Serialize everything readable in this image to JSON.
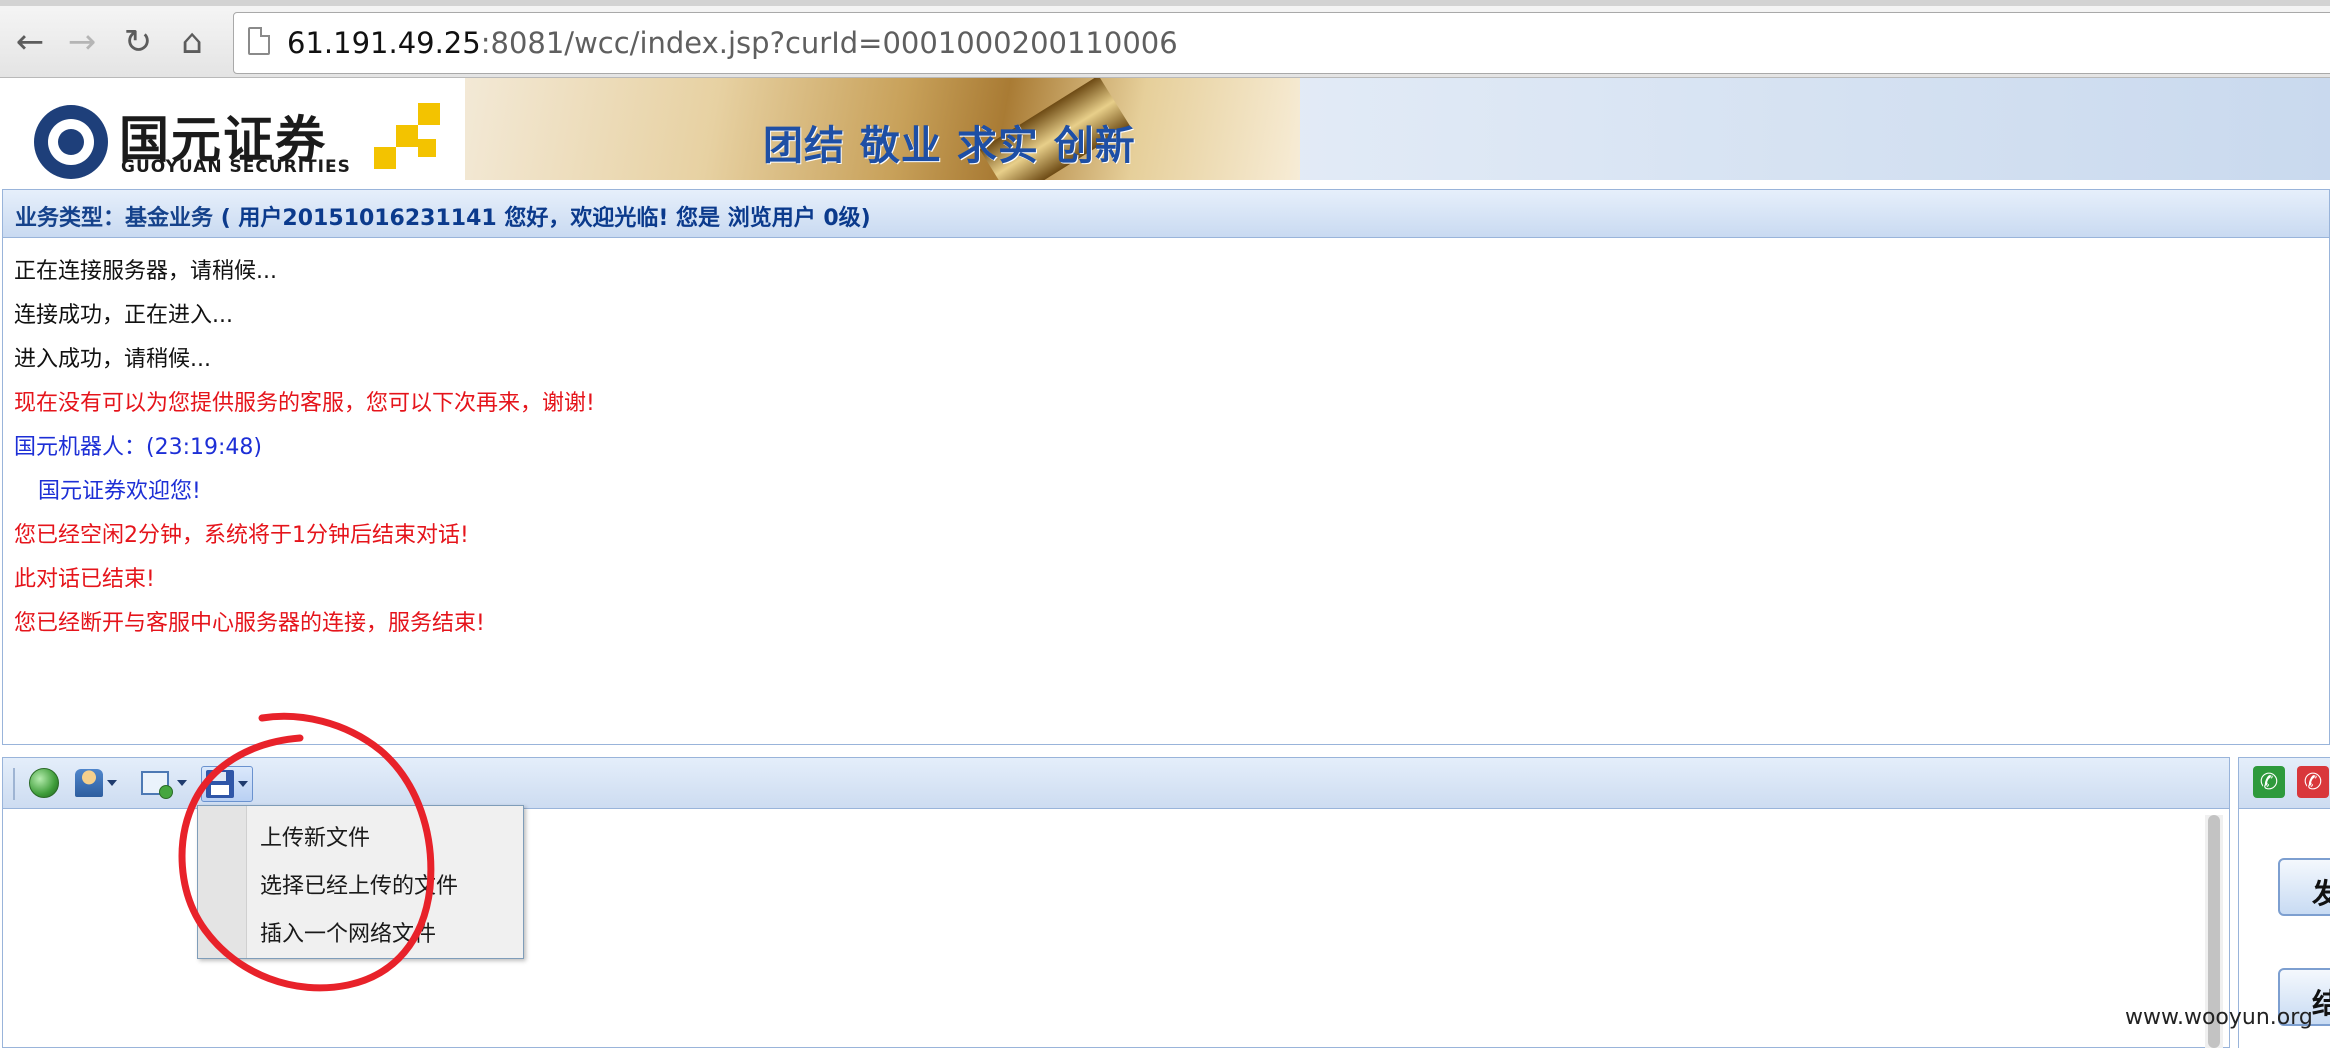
{
  "browser": {
    "url_host": "61.191.49.25",
    "url_rest": ":8081/wcc/index.jsp?curId=0001000200110006",
    "back_icon": "←",
    "forward_icon": "→",
    "reload_icon": "↻",
    "home_icon": "⌂"
  },
  "site": {
    "logo_cn": "国元证券",
    "logo_en": "GUOYUAN SECURITIES",
    "slogan": "团结 敬业 求实 创新",
    "brand_color": "#1e3f7a"
  },
  "status": {
    "label": "业务类型：基金业务",
    "user_text": "( 用户20151016231141 您好，欢迎光临! 您是 浏览用户 0级)"
  },
  "messages": [
    {
      "text": "正在连接服务器，请稍候...",
      "color": "black"
    },
    {
      "text": "连接成功，正在进入...",
      "color": "black"
    },
    {
      "text": "进入成功，请稍候...",
      "color": "black"
    },
    {
      "text": "现在没有可以为您提供服务的客服，您可以下次再来，谢谢!",
      "color": "red"
    },
    {
      "text": "国元机器人：(23:19:48)",
      "color": "blue"
    },
    {
      "text": "   国元证券欢迎您!",
      "color": "blue"
    },
    {
      "text": "您已经空闲2分钟，系统将于1分钟后结束对话!",
      "color": "red"
    },
    {
      "text": "此对话已结束!",
      "color": "red"
    },
    {
      "text": "您已经断开与客服中心服务器的连接，服务结束!",
      "color": "red"
    }
  ],
  "toolbar": {
    "icons": [
      "globe-icon",
      "user-icon",
      "screen-capture-icon",
      "save-file-icon"
    ]
  },
  "file_menu": {
    "items": [
      "上传新文件",
      "选择已经上传的文件",
      "插入一个网络文件"
    ]
  },
  "side_buttons": {
    "send_label": "发",
    "end_label": "结"
  },
  "watermark": "www.wooyun.org",
  "colors": {
    "red_text": "#e5141b",
    "blue_text": "#1d2fd6",
    "annotation_red": "#e8222a"
  }
}
